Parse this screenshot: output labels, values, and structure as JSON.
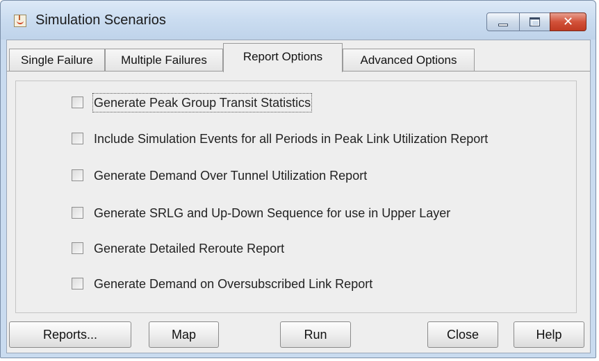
{
  "window": {
    "title": "Simulation Scenarios",
    "close_glyph": "✕"
  },
  "tabs": [
    {
      "label": "Single Failure",
      "active": false
    },
    {
      "label": "Multiple Failures",
      "active": false
    },
    {
      "label": "Report Options",
      "active": true
    },
    {
      "label": "Advanced Options",
      "active": false
    }
  ],
  "options": [
    {
      "label": "Generate Peak Group Transit Statistics",
      "checked": false
    },
    {
      "label": "Include Simulation Events for all Periods in Peak Link Utilization Report",
      "checked": false
    },
    {
      "label": "Generate Demand Over Tunnel Utilization Report",
      "checked": false
    },
    {
      "label": "Generate SRLG and Up-Down Sequence for use in Upper Layer",
      "checked": false
    },
    {
      "label": "Generate Detailed Reroute Report",
      "checked": false
    },
    {
      "label": "Generate Demand on Oversubscribed Link Report",
      "checked": false
    }
  ],
  "buttons": {
    "reports": "Reports...",
    "map": "Map",
    "run": "Run",
    "close": "Close",
    "help": "Help"
  },
  "colors": {
    "title_bar": "#cadcf0",
    "close_button": "#d2523a",
    "panel_background": "#eeeeee"
  },
  "icons": {
    "app": "java-coffee-cup-icon",
    "minimize": "minimize-icon",
    "maximize": "maximize-icon",
    "close": "close-icon"
  }
}
